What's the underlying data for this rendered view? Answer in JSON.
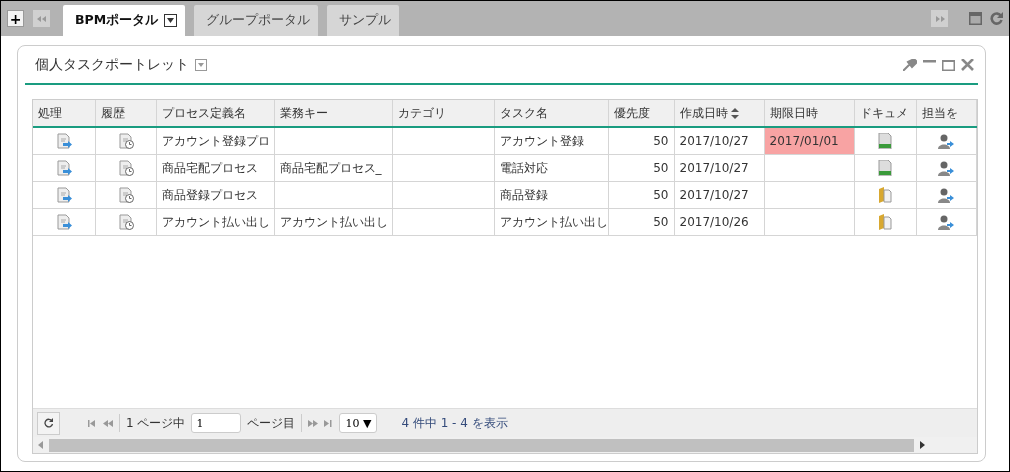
{
  "tabs": [
    {
      "label": "BPMポータル",
      "selected": true
    },
    {
      "label": "グループポータル",
      "selected": false
    },
    {
      "label": "サンプル",
      "selected": false
    }
  ],
  "add_button": "+",
  "portlet": {
    "title": "個人タスクポートレット",
    "columns": [
      {
        "label": "処理",
        "sort": false
      },
      {
        "label": "履歴",
        "sort": false
      },
      {
        "label": "プロセス定義名",
        "sort": false
      },
      {
        "label": "業務キー",
        "sort": false
      },
      {
        "label": "カテゴリ",
        "sort": false
      },
      {
        "label": "タスク名",
        "sort": false
      },
      {
        "label": "優先度",
        "sort": false
      },
      {
        "label": "作成日時",
        "sort": true
      },
      {
        "label": "期限日時",
        "sort": false
      },
      {
        "label": "ドキュメ",
        "sort": false
      },
      {
        "label": "担当を",
        "sort": false
      }
    ],
    "rows": [
      {
        "process": "アカウント登録プロ",
        "business_key": "",
        "task": "アカウント登録",
        "priority": "50",
        "created": "2017/10/27",
        "deadline": "2017/01/01",
        "overdue": true,
        "kind": "document"
      },
      {
        "process": "商品宅配プロセス",
        "business_key": "商品宅配プロセス_",
        "task": "電話対応",
        "priority": "50",
        "created": "2017/10/27",
        "deadline": "",
        "overdue": false,
        "kind": "document"
      },
      {
        "process": "商品登録プロセス",
        "business_key": "",
        "task": "商品登録",
        "priority": "50",
        "created": "2017/10/27",
        "deadline": "",
        "overdue": false,
        "kind": "folder"
      },
      {
        "process": "アカウント払い出し",
        "business_key": "アカウント払い出し",
        "task": "アカウント払い出し",
        "priority": "50",
        "created": "2017/10/26",
        "deadline": "",
        "overdue": false,
        "kind": "folder"
      }
    ],
    "pager": {
      "page_of": "1 ページ中",
      "page_input": "1",
      "page_suffix": "ページ目",
      "page_size": "10 ▼",
      "summary": "4 件中 1 - 4 を表示"
    }
  }
}
